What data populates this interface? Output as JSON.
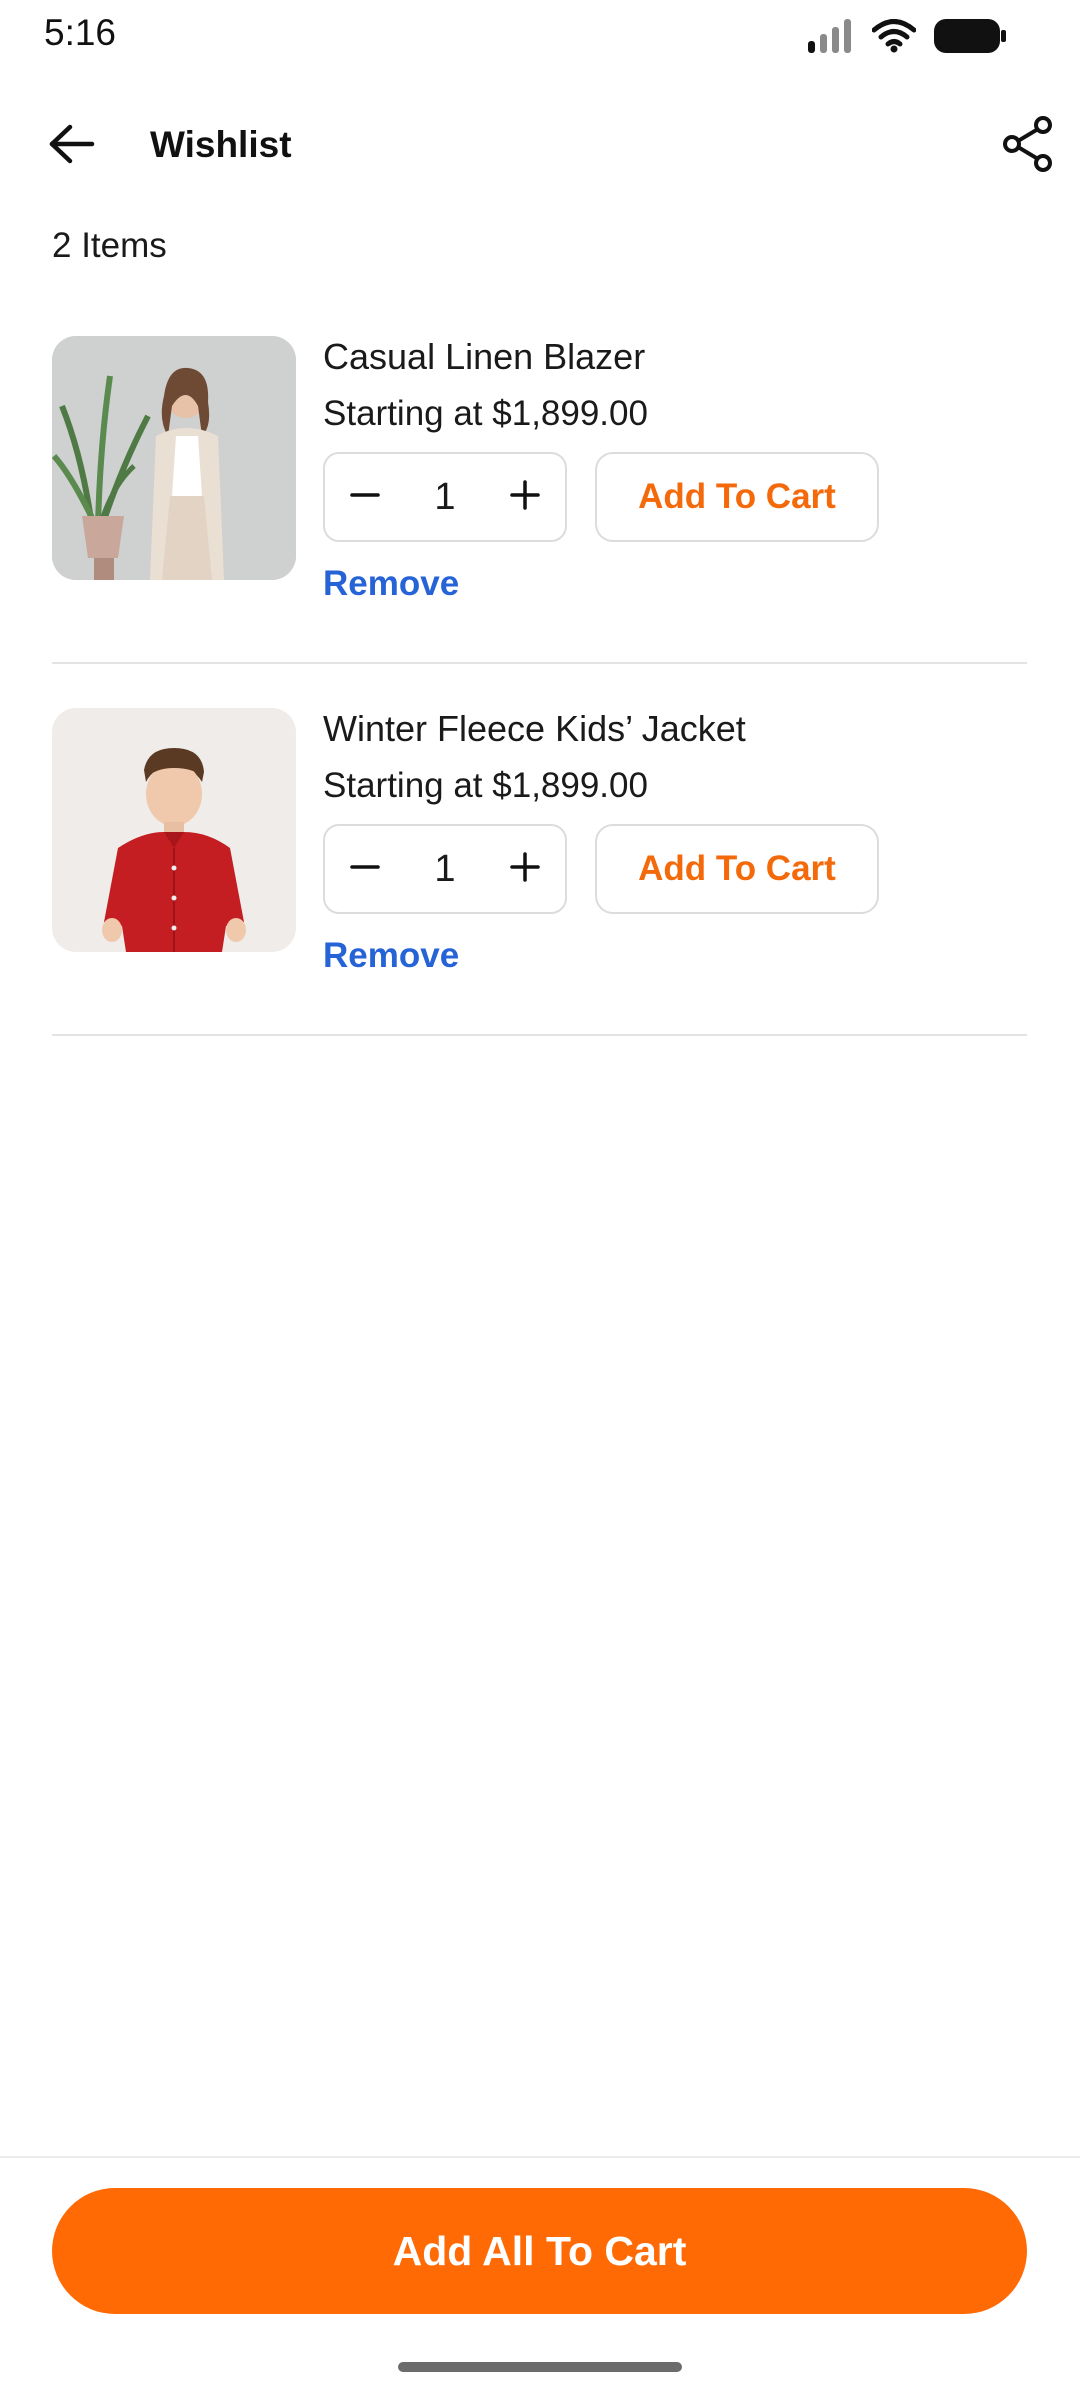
{
  "status_bar": {
    "time": "5:16",
    "icons": [
      "signal-icon",
      "wifi-icon",
      "battery-icon"
    ]
  },
  "header": {
    "title": "Wishlist",
    "back_icon": "arrow-left-icon",
    "share_icon": "share-icon"
  },
  "item_count": "2 Items",
  "items": [
    {
      "name": "Casual Linen Blazer",
      "price": "Starting at $1,899.00",
      "quantity": "1",
      "add_to_cart_label": "Add To Cart",
      "remove_label": "Remove",
      "image": "woman-in-linen-blazer-photo"
    },
    {
      "name": "Winter Fleece Kids’ Jacket",
      "price": "Starting at $1,899.00",
      "quantity": "1",
      "add_to_cart_label": "Add To Cart",
      "remove_label": "Remove",
      "image": "boy-in-red-shirt-photo"
    }
  ],
  "footer": {
    "add_all_label": "Add All To Cart"
  },
  "colors": {
    "accent": "#ff6a05",
    "accent_text": "#f46a0a",
    "link": "#2563d6",
    "divider": "#e3e3e3"
  }
}
